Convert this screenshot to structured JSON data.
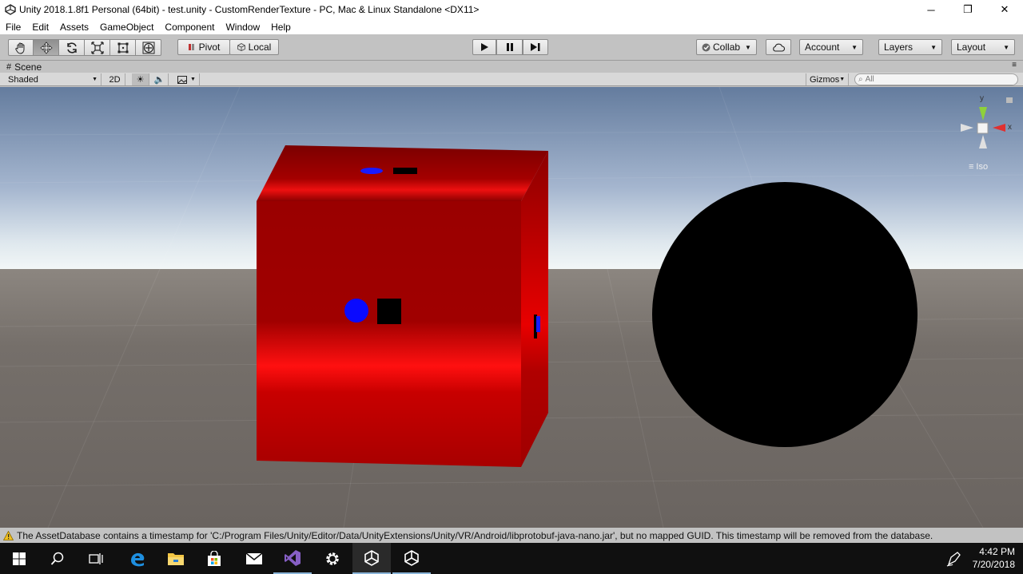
{
  "window": {
    "title": "Unity 2018.1.8f1 Personal (64bit) - test.unity - CustomRenderTexture - PC, Mac & Linux Standalone <DX11>",
    "minimize": "─",
    "maximize": "❐",
    "close": "✕"
  },
  "menu": [
    "File",
    "Edit",
    "Assets",
    "GameObject",
    "Component",
    "Window",
    "Help"
  ],
  "toolbar": {
    "pivot": "Pivot",
    "local": "Local",
    "collab": "Collab",
    "account": "Account",
    "layers": "Layers",
    "layout": "Layout"
  },
  "scene": {
    "tab_label": "Scene",
    "draw_mode": "Shaded",
    "two_d": "2D",
    "gizmos": "Gizmos",
    "search_placeholder": "All",
    "gizmo_y": "y",
    "gizmo_x": "x",
    "projection": "Iso"
  },
  "status": {
    "message": "The AssetDatabase contains a timestamp for 'C:/Program Files/Unity/Editor/Data/UnityExtensions/Unity/VR/Android/libprotobuf-java-nano.jar', but no mapped GUID. This timestamp will be removed from the database."
  },
  "taskbar": {
    "time": "4:42 PM",
    "date": "7/20/2018",
    "apps": [
      "start-icon",
      "search-icon",
      "task-view-icon",
      "edge-icon",
      "file-explorer-icon",
      "store-icon",
      "mail-icon",
      "visual-studio-icon",
      "settings-icon",
      "unity-icon",
      "unity-icon"
    ]
  },
  "colors": {
    "cube_red": "#b00000",
    "sky": "#8fa4c4",
    "ground": "#6f6a66",
    "accent_blue": "#0000ff"
  }
}
